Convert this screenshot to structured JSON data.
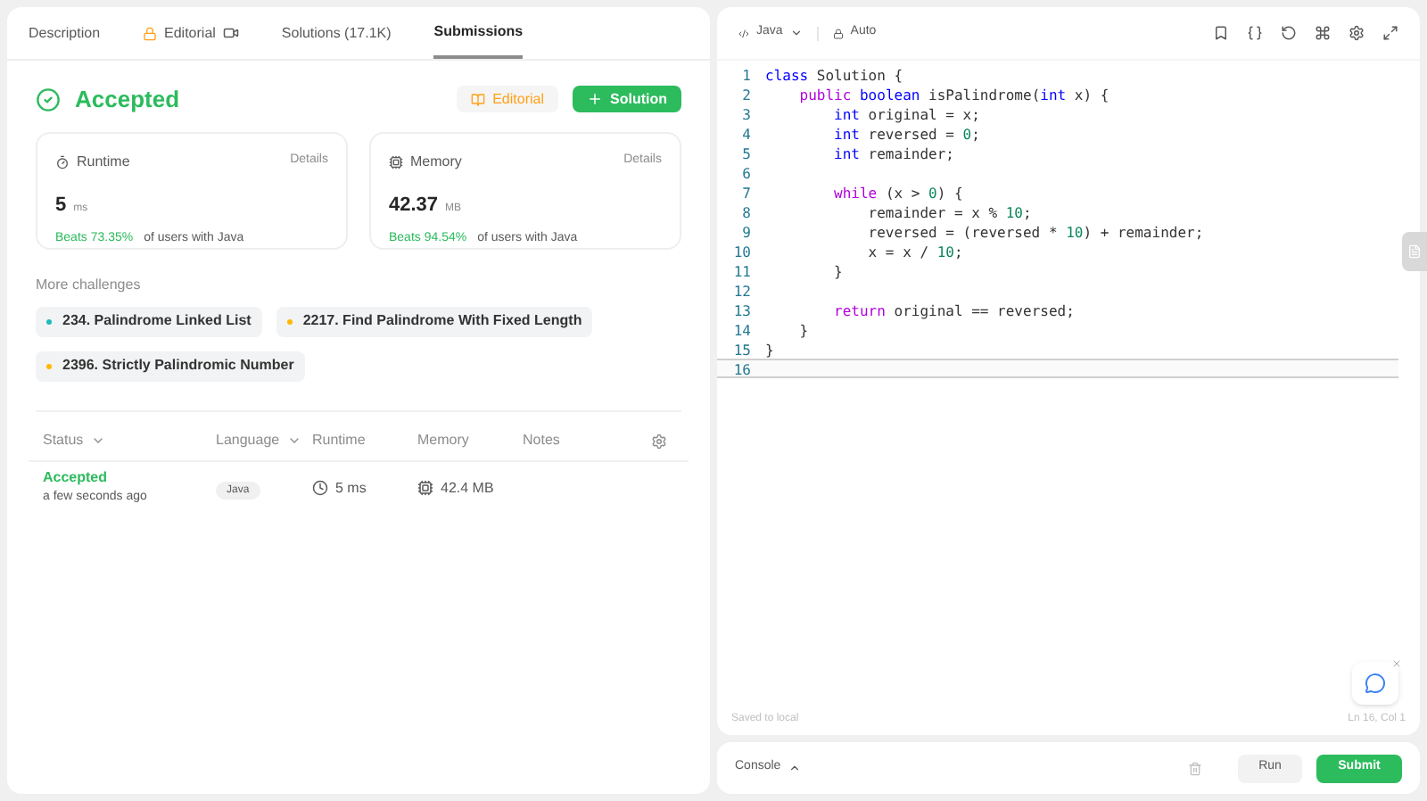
{
  "tabs": [
    {
      "label": "Description",
      "selected": false,
      "kind": "plain"
    },
    {
      "label": "Editorial",
      "selected": false,
      "kind": "locked"
    },
    {
      "label": "Solutions (17.1K)",
      "selected": false,
      "kind": "plain"
    },
    {
      "label": "Submissions",
      "selected": true,
      "kind": "plain"
    }
  ],
  "result": {
    "status": "Accepted",
    "editorial_button": "Editorial",
    "solution_button": "Solution"
  },
  "stats": [
    {
      "kind": "runtime",
      "title": "Runtime",
      "details": "Details",
      "value": "5",
      "unit": "ms",
      "beats": "Beats 73.35%",
      "suffix": "of users with Java"
    },
    {
      "kind": "memory",
      "title": "Memory",
      "details": "Details",
      "value": "42.37",
      "unit": "MB",
      "beats": "Beats 94.54%",
      "suffix": "of users with Java"
    }
  ],
  "challenges": {
    "title": "More challenges",
    "items": [
      {
        "label": "234. Palindrome Linked List",
        "color": "#1cbaba"
      },
      {
        "label": "2217. Find Palindrome With Fixed Length",
        "color": "#ffb800"
      },
      {
        "label": "2396. Strictly Palindromic Number",
        "color": "#ffb800"
      }
    ]
  },
  "submissions": {
    "columns": [
      {
        "label": "Status",
        "sortable": true
      },
      {
        "label": "Language",
        "sortable": true
      },
      {
        "label": "Runtime",
        "sortable": false
      },
      {
        "label": "Memory",
        "sortable": false
      },
      {
        "label": "Notes",
        "sortable": false
      }
    ],
    "rows": [
      {
        "status": "Accepted",
        "time": "a few seconds ago",
        "language": "Java",
        "runtime": "5 ms",
        "memory": "42.4 MB"
      }
    ]
  },
  "editor": {
    "language": "Java",
    "mode": "Auto",
    "lines": [
      {
        "number": "1",
        "current": false,
        "tokens": [
          {
            "text": "class",
            "kind": "type"
          },
          {
            "text": " Solution {",
            "kind": "plain"
          }
        ]
      },
      {
        "number": "2",
        "current": false,
        "tokens": [
          {
            "text": "    public",
            "kind": "kw"
          },
          {
            "text": " boolean",
            "kind": "type"
          },
          {
            "text": " isPalindrome(",
            "kind": "plain"
          },
          {
            "text": "int",
            "kind": "type"
          },
          {
            "text": " x) {",
            "kind": "plain"
          }
        ]
      },
      {
        "number": "3",
        "current": false,
        "tokens": [
          {
            "text": "        int",
            "kind": "type"
          },
          {
            "text": " original = x;",
            "kind": "plain"
          }
        ]
      },
      {
        "number": "4",
        "current": false,
        "tokens": [
          {
            "text": "        int",
            "kind": "type"
          },
          {
            "text": " reversed = ",
            "kind": "plain"
          },
          {
            "text": "0",
            "kind": "num"
          },
          {
            "text": ";",
            "kind": "plain"
          }
        ]
      },
      {
        "number": "5",
        "current": false,
        "tokens": [
          {
            "text": "        int",
            "kind": "type"
          },
          {
            "text": " remainder;",
            "kind": "plain"
          }
        ]
      },
      {
        "number": "6",
        "current": false
      },
      {
        "number": "7",
        "current": false,
        "tokens": [
          {
            "text": "        while",
            "kind": "kw"
          },
          {
            "text": " (x > ",
            "kind": "plain"
          },
          {
            "text": "0",
            "kind": "num"
          },
          {
            "text": ") {",
            "kind": "plain"
          }
        ]
      },
      {
        "number": "8",
        "current": false,
        "tokens": [
          {
            "text": "            remainder = x % ",
            "kind": "plain"
          },
          {
            "text": "10",
            "kind": "num"
          },
          {
            "text": ";",
            "kind": "plain"
          }
        ]
      },
      {
        "number": "9",
        "current": false,
        "tokens": [
          {
            "text": "            reversed = (reversed * ",
            "kind": "plain"
          },
          {
            "text": "10",
            "kind": "num"
          },
          {
            "text": ") + remainder;",
            "kind": "plain"
          }
        ]
      },
      {
        "number": "10",
        "current": false,
        "tokens": [
          {
            "text": "            x = x / ",
            "kind": "plain"
          },
          {
            "text": "10",
            "kind": "num"
          },
          {
            "text": ";",
            "kind": "plain"
          }
        ]
      },
      {
        "number": "11",
        "current": false,
        "tokens": [
          {
            "text": "        }",
            "kind": "plain"
          }
        ]
      },
      {
        "number": "12",
        "current": false
      },
      {
        "number": "13",
        "current": false,
        "tokens": [
          {
            "text": "        return",
            "kind": "kw"
          },
          {
            "text": " original == reversed;",
            "kind": "plain"
          }
        ]
      },
      {
        "number": "14",
        "current": false,
        "tokens": [
          {
            "text": "    }",
            "kind": "plain"
          }
        ]
      },
      {
        "number": "15",
        "current": false,
        "tokens": [
          {
            "text": "}",
            "kind": "plain"
          }
        ]
      },
      {
        "number": "16",
        "current": true
      }
    ],
    "saved": "Saved to local",
    "cursor": "Ln 16, Col 1"
  },
  "console": {
    "label": "Console",
    "run": "Run",
    "submit": "Submit"
  }
}
